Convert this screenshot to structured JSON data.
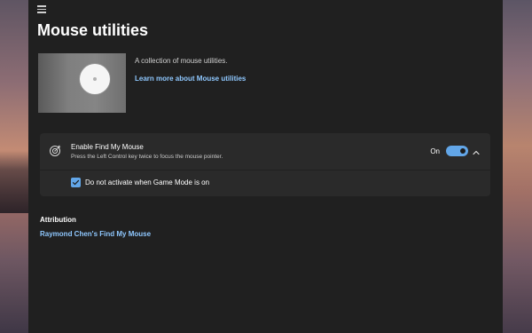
{
  "page": {
    "title": "Mouse utilities"
  },
  "hero": {
    "description": "A collection of mouse utilities.",
    "link_label": "Learn more about Mouse utilities"
  },
  "find_my_mouse": {
    "title": "Enable Find My Mouse",
    "description": "Press the Left Control key twice to focus the mouse pointer.",
    "toggle_label": "On",
    "toggle_state": "on",
    "expanded": true,
    "option_label": "Do not activate when Game Mode is on",
    "option_checked": true
  },
  "attribution": {
    "title": "Attribution",
    "link_label": "Raymond Chen's Find My Mouse"
  },
  "colors": {
    "accent": "#62a6e8",
    "link": "#8fc8ff",
    "window_bg": "#202020",
    "card_bg": "#2a2a2a"
  },
  "icons": {
    "menu": "hamburger-icon",
    "setting": "target-icon",
    "expand": "chevron-up-icon",
    "check": "checkmark-icon"
  }
}
